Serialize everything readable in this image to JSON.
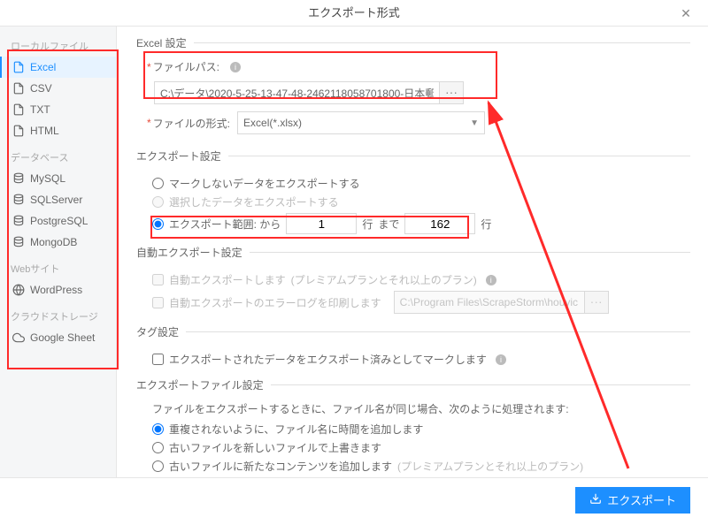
{
  "title": "エクスポート形式",
  "close_glyph": "✕",
  "sidebar": {
    "groups": [
      {
        "label": "ローカルファイル",
        "items": [
          {
            "key": "excel",
            "label": "Excel",
            "active": true
          },
          {
            "key": "csv",
            "label": "CSV"
          },
          {
            "key": "txt",
            "label": "TXT"
          },
          {
            "key": "html",
            "label": "HTML"
          }
        ]
      },
      {
        "label": "データベース",
        "items": [
          {
            "key": "mysql",
            "label": "MySQL"
          },
          {
            "key": "sqlserver",
            "label": "SQLServer"
          },
          {
            "key": "postgresql",
            "label": "PostgreSQL"
          },
          {
            "key": "mongodb",
            "label": "MongoDB"
          }
        ]
      },
      {
        "label": "Webサイト",
        "items": [
          {
            "key": "wordpress",
            "label": "WordPress"
          }
        ]
      },
      {
        "label": "クラウドストレージ",
        "items": [
          {
            "key": "googlesheet",
            "label": "Google Sheet"
          }
        ]
      }
    ]
  },
  "excel_settings": {
    "legend": "Excel 設定",
    "filepath_label": "ファイルパス:",
    "filepath_value": "C:\\データ\\2020-5-25-13-47-48-2462118058701800-日本郵",
    "browse": "···",
    "format_label": "ファイルの形式:",
    "format_value": "Excel(*.xlsx)"
  },
  "export_settings": {
    "legend": "エクスポート設定",
    "opt_unmarked": "マークしないデータをエクスポートする",
    "opt_selected": "選択したデータをエクスポートする",
    "opt_range_label": "エクスポート範囲: から",
    "from_value": "1",
    "unit_row": "行",
    "to_label": "まで",
    "to_value": "162",
    "unit_row2": "行"
  },
  "auto_export": {
    "legend": "自動エクスポート設定",
    "chk_auto": "自動エクスポートします",
    "plan_note": "(プレミアムプランとそれ以上のプラン)",
    "chk_log": "自動エクスポートのエラーログを印刷します",
    "log_path": "C:\\Program Files\\ScrapeStorm\\houyic",
    "browse": "···"
  },
  "tag_settings": {
    "legend": "タグ設定",
    "chk_mark": "エクスポートされたデータをエクスポート済みとしてマークします"
  },
  "file_settings": {
    "legend": "エクスポートファイル設定",
    "note": "ファイルをエクスポートするときに、ファイル名が同じ場合、次のように処理されます:",
    "opt_time": "重複されないように、ファイル名に時間を追加します",
    "opt_overwrite": "古いファイルを新しいファイルで上書きます",
    "opt_append": "古いファイルに新たなコンテンツを追加します",
    "plan_note": "(プレミアムプランとそれ以上のプラン)"
  },
  "export_button": "エクスポート",
  "icons": {
    "file": "file-icon",
    "db": "db-icon",
    "wp": "wp-icon",
    "cloud": "cloud-icon",
    "download": "download-icon"
  }
}
